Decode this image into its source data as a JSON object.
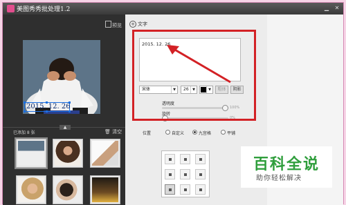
{
  "window": {
    "title": "美图秀秀批处理1.2"
  },
  "left_panel": {
    "preview_label": "预览",
    "photo_overlay_text": "2015. 12. 26",
    "added_label": "已添加 8 张",
    "clear_label": "清空"
  },
  "text_panel": {
    "section_title": "文字",
    "text_value": "2015. 12. 26",
    "font": "宋体",
    "size": "26",
    "bold_label": "粗体",
    "shadow_label": "阴影",
    "opacity_label": "透明度",
    "opacity_pct": "100%",
    "rotation_label": "旋转",
    "rotation_pct": "0%",
    "position_label": "位置",
    "position_options": [
      "自定义",
      "九宫格",
      "平铺"
    ],
    "selected_position": "九宫格"
  },
  "controls": {
    "opacity_value": 1.0,
    "rotation_value": 0.0
  },
  "watermark": {
    "title": "百科全说",
    "subtitle": "助你轻松解决"
  },
  "colors": {
    "accent_red": "#d32125",
    "brand_green": "#2f9e3c",
    "app_pink": "#e24d8d"
  }
}
